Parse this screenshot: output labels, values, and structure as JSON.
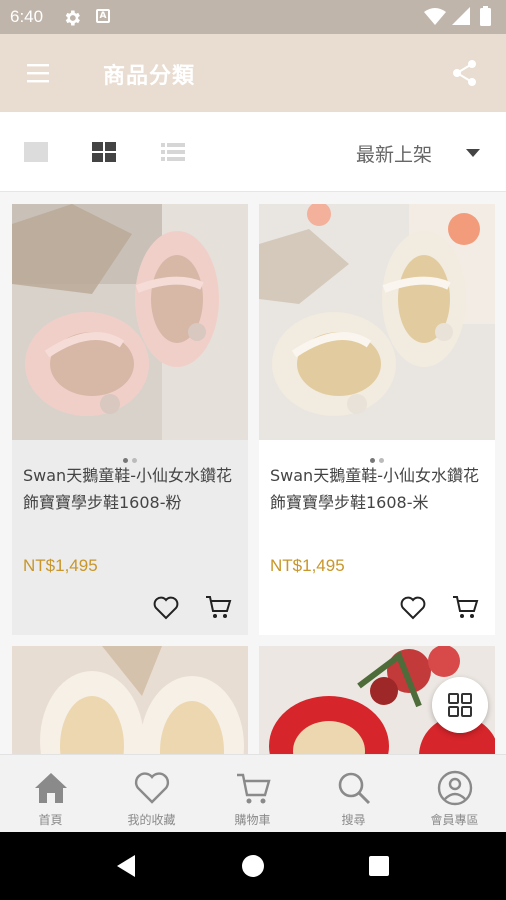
{
  "status_bar": {
    "time": "6:40",
    "icons": [
      "gear-icon",
      "a-badge-icon",
      "wifi-icon",
      "signal-icon",
      "battery-icon"
    ]
  },
  "app_bar": {
    "title": "商品分類",
    "menu_icon": "hamburger-menu-icon",
    "share_icon": "share-icon"
  },
  "toolbar": {
    "views": [
      "single-view-icon",
      "grid-view-icon",
      "list-view-icon"
    ],
    "active_view": "grid-view-icon",
    "sort_label": "最新上架"
  },
  "products": [
    {
      "name": "Swan天鵝童鞋-小仙女水鑽花飾寶寶學步鞋1608-粉",
      "price": "NT$1,495",
      "image_dots": 2,
      "active_dot": 0,
      "shoe_color": "#f1cfc9"
    },
    {
      "name": "Swan天鵝童鞋-小仙女水鑽花飾寶寶學步鞋1608-米",
      "price": "NT$1,495",
      "image_dots": 2,
      "active_dot": 0,
      "shoe_color": "#f2ebdf"
    }
  ],
  "bottom_nav": {
    "items": [
      {
        "label": "首頁",
        "icon": "home-icon"
      },
      {
        "label": "我的收藏",
        "icon": "heart-icon"
      },
      {
        "label": "購物車",
        "icon": "cart-icon"
      },
      {
        "label": "搜尋",
        "icon": "search-icon"
      },
      {
        "label": "會員專區",
        "icon": "user-icon"
      }
    ],
    "active_index": 0
  },
  "colors": {
    "app_bar": "#e9dcd0",
    "status_bar": "#bfb5ab",
    "price": "#c8962a",
    "icon_gray": "#8a8a8a"
  }
}
